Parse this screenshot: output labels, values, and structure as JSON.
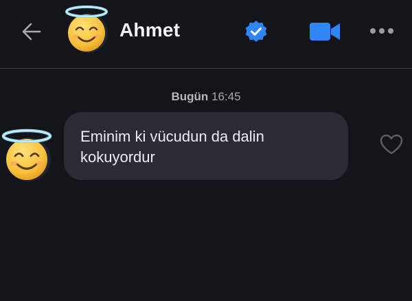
{
  "header": {
    "contact_name": "Ahmet",
    "icons": {
      "back": "back-arrow-icon",
      "avatar": "halo-smiling-face-emoji",
      "verified": "verified-badge-icon",
      "video": "video-call-icon",
      "more": "more-options-icon"
    }
  },
  "conversation": {
    "timestamp_day": "Bugün",
    "timestamp_time": "16:45",
    "messages": [
      {
        "text": "Eminim ki vücudun da dalin kokuyordur",
        "sender": "other",
        "reaction_icon": "heart-outline-icon"
      }
    ]
  },
  "colors": {
    "background": "#13151b",
    "bubble": "#2a2c35",
    "accent_blue": "#2f86f6",
    "divider": "#3a3d45"
  }
}
